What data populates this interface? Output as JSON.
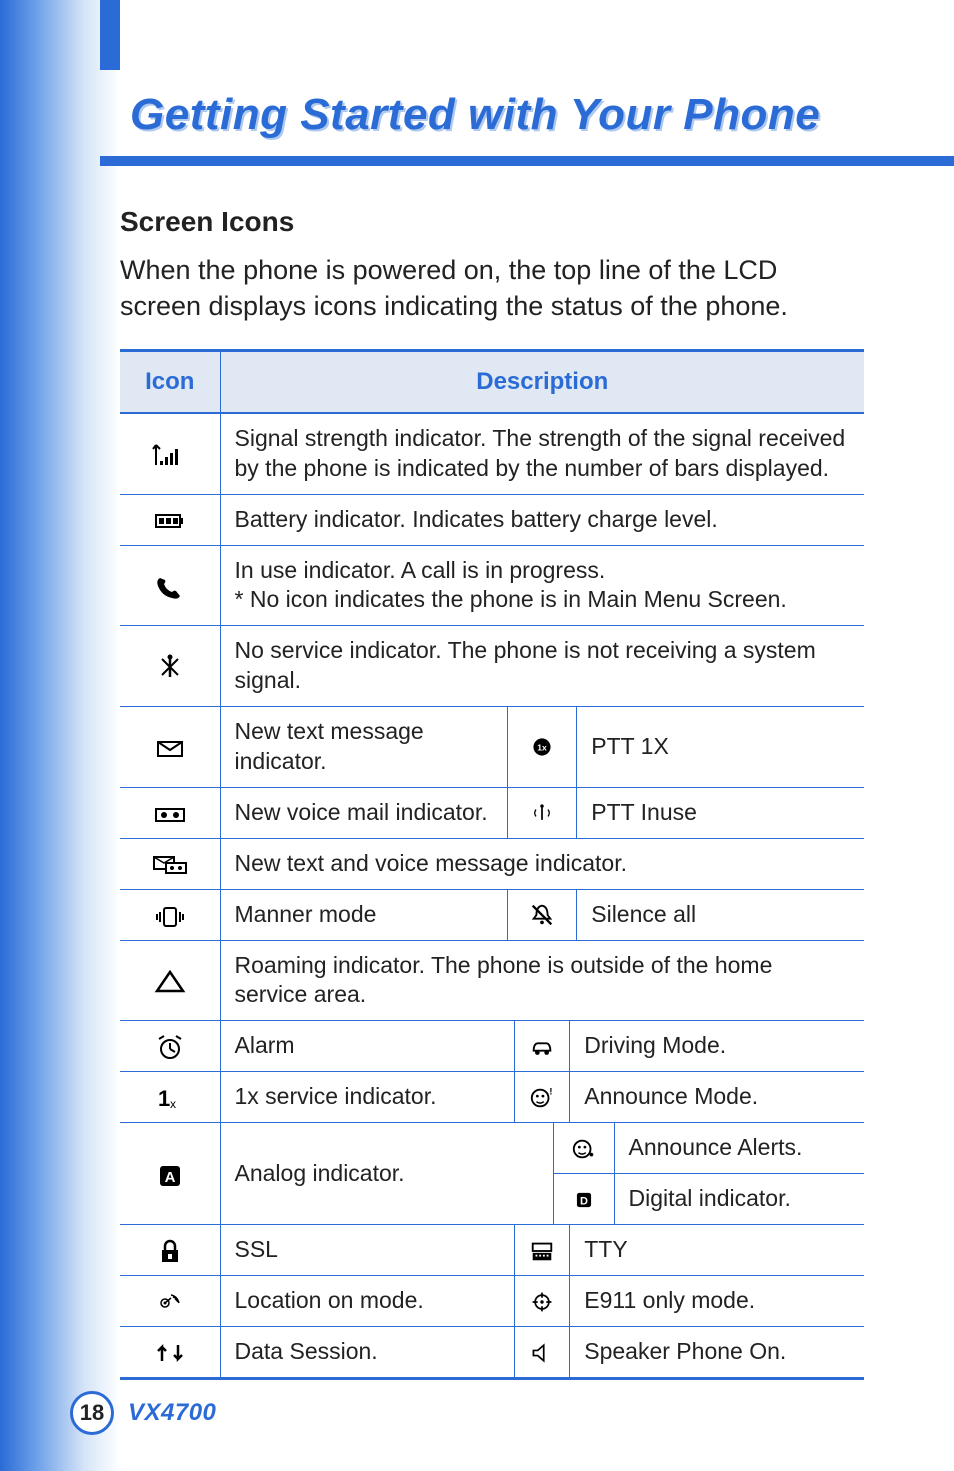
{
  "title": "Getting Started with Your Phone",
  "section_heading": "Screen Icons",
  "intro": "When the phone is powered on, the top line of the LCD screen displays icons indicating the status of the phone.",
  "table": {
    "header_icon": "Icon",
    "header_desc": "Description",
    "rows": {
      "signal": "Signal strength indicator. The strength of the signal received by the phone is indicated by the number of bars displayed.",
      "battery": "Battery indicator. Indicates battery charge level.",
      "inuse": "In use indicator. A call is in progress.\n* No icon indicates the phone is in Main Menu Screen.",
      "noservice": "No service indicator. The phone is not receiving a system signal.",
      "newtext": "New text message indicator.",
      "ptt1x": "PTT 1X",
      "newvoice": "New voice mail indicator.",
      "pttinuse": "PTT Inuse",
      "textandvoice": "New text and voice message indicator.",
      "manner": "Manner mode",
      "silenceall": "Silence all",
      "roaming": "Roaming indicator. The phone is outside of the home service area.",
      "alarm": "Alarm",
      "driving": "Driving Mode.",
      "onex": "1x service indicator.",
      "announce": "Announce Mode.",
      "analog": "Analog indicator.",
      "announcealerts": "Announce Alerts.",
      "digital": "Digital indicator.",
      "ssl": "SSL",
      "tty": "TTY",
      "location": "Location on mode.",
      "e911": "E911 only mode.",
      "datasession": "Data Session.",
      "speaker": "Speaker Phone On."
    }
  },
  "footer": {
    "page": "18",
    "model": "VX4700"
  },
  "icons": {
    "signal": "signal-strength-icon",
    "battery": "battery-icon",
    "inuse": "phone-handset-icon",
    "noservice": "antenna-crossed-icon",
    "newtext": "envelope-icon",
    "ptt1x": "ptt-1x-icon",
    "newvoice": "voicemail-tape-icon",
    "pttinuse": "ptt-antenna-icon",
    "textandvoice": "envelope-tape-icon",
    "manner": "vibrate-icon",
    "silenceall": "bell-slash-icon",
    "roaming": "triangle-icon",
    "alarm": "alarm-clock-icon",
    "driving": "car-icon",
    "onex": "one-x-icon",
    "announce": "announce-face-icon",
    "analog": "a-box-icon",
    "announcealerts": "announce-face-alert-icon",
    "digital": "d-box-icon",
    "ssl": "lock-icon",
    "tty": "tty-icon",
    "location": "satellite-signal-icon",
    "e911": "crosshair-icon",
    "datasession": "arrows-updown-icon",
    "speaker": "speaker-icon"
  }
}
